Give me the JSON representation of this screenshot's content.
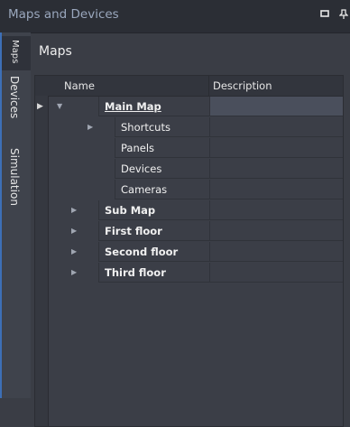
{
  "window": {
    "title": "Maps and Devices",
    "pin_icon": "pin-icon",
    "dock_icon": "dock-pin-icon"
  },
  "side_tabs": [
    {
      "label": "Maps",
      "active": true
    },
    {
      "label": "Devices",
      "active": false
    },
    {
      "label": "Simulation",
      "active": false
    }
  ],
  "panel": {
    "title": "Maps"
  },
  "grid": {
    "columns": [
      "Name",
      "Description"
    ],
    "rows": [
      {
        "name": "Main Map",
        "description": "",
        "expanded": true,
        "level": 0,
        "bold": true,
        "underline": true,
        "selected": true,
        "current": true
      },
      {
        "name": "Shortcuts",
        "description": "",
        "expanded": false,
        "level": 1,
        "bold": false,
        "has_children": true
      },
      {
        "name": "Panels",
        "description": "",
        "level": 1,
        "bold": false,
        "has_children": false
      },
      {
        "name": "Devices",
        "description": "",
        "level": 1,
        "bold": false,
        "has_children": false
      },
      {
        "name": "Cameras",
        "description": "",
        "level": 1,
        "bold": false,
        "has_children": false
      },
      {
        "name": "Sub Map",
        "description": "",
        "expanded": false,
        "level": 0,
        "bold": true,
        "has_children": true
      },
      {
        "name": "First floor",
        "description": "",
        "expanded": false,
        "level": 0,
        "bold": true,
        "has_children": true
      },
      {
        "name": "Second floor",
        "description": "",
        "expanded": false,
        "level": 0,
        "bold": true,
        "has_children": true
      },
      {
        "name": "Third floor",
        "description": "",
        "expanded": false,
        "level": 0,
        "bold": true,
        "has_children": true
      }
    ]
  },
  "colors": {
    "accent": "#3d6fb6",
    "background": "#3a3d45",
    "selected_desc": "#4a4f5c"
  }
}
